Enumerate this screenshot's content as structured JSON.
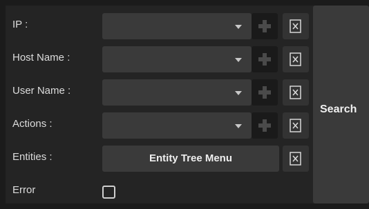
{
  "form": {
    "ip_label": "IP :",
    "host_label": "Host Name :",
    "user_label": "User Name :",
    "actions_label": "Actions :",
    "entities_label": "Entities :",
    "entity_tree_button": "Entity Tree Menu",
    "error_label": "Error",
    "error_checked": false
  },
  "search_button": "Search",
  "icons": {
    "dropdown": "chevron-down-icon",
    "add": "plus-icon",
    "clear": "clear-x-icon"
  }
}
